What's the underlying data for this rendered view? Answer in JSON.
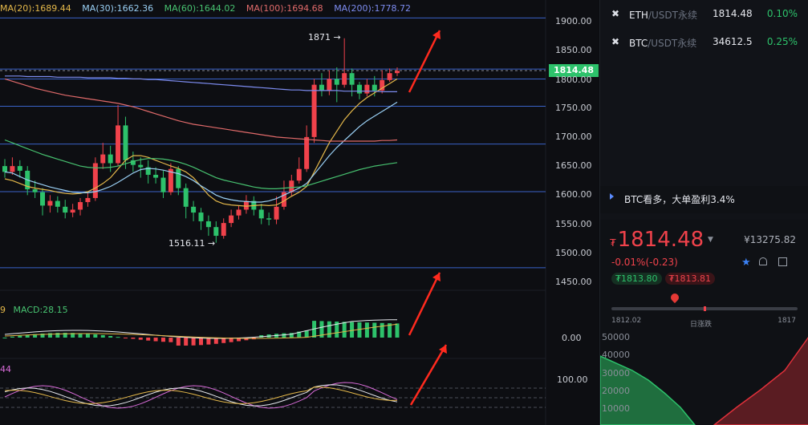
{
  "ma_legend": [
    {
      "label": "MA(20):1689.44",
      "color": "#e4b84a"
    },
    {
      "label": "MA(30):1662.36",
      "color": "#9ad0f5"
    },
    {
      "label": "MA(60):1644.02",
      "color": "#47c270"
    },
    {
      "label": "MA(100):1694.68",
      "color": "#e06a6a"
    },
    {
      "label": "MA(200):1778.72",
      "color": "#7d8cf0"
    }
  ],
  "annotations": {
    "high": "1871",
    "low": "1516.11",
    "current_price_tag": "1814.48"
  },
  "price_axis": [
    "1900.00",
    "1850.00",
    "1800.00",
    "1750.00",
    "1700.00",
    "1650.00",
    "1600.00",
    "1550.00",
    "1500.00",
    "1450.00"
  ],
  "macd": {
    "prefix": "9",
    "label": "MACD:28.15",
    "axis": "0.00"
  },
  "kdj": {
    "prefix": "44",
    "axis": "100.00"
  },
  "tickers": [
    {
      "symbol": "ETH",
      "pair": "/USDT永续",
      "price": "1814.48",
      "change": "0.10%"
    },
    {
      "symbol": "BTC",
      "pair": "/USDT永续",
      "price": "34612.5",
      "change": "0.25%"
    }
  ],
  "news": "BTC看多，大单盈利3.4%",
  "quote": {
    "currency": "₮",
    "price": "1814.48",
    "volume": "¥13275.82",
    "change": "-0.01%(-0.23)",
    "bid": "₮1813.80",
    "ask": "₮1813.81",
    "range_low": "1812.02",
    "range_high": "1817",
    "range_title": "日涨跌",
    "range_position": 0.5
  },
  "depth_axis": [
    "50000",
    "40000",
    "30000",
    "20000",
    "10000"
  ],
  "colors": {
    "up": "#2dc26b",
    "down": "#f0424b",
    "accent": "#3b82f6",
    "price_tag_bg": "#2dc26b"
  },
  "chart_data": {
    "type": "candlestick",
    "ylim": [
      1440,
      1915
    ],
    "horizontal_levels": [
      1905,
      1817,
      1800,
      1753,
      1688,
      1606,
      1475
    ],
    "candles": [
      [
        1650,
        1640,
        1662,
        1630
      ],
      [
        1640,
        1650,
        1665,
        1635
      ],
      [
        1650,
        1642,
        1660,
        1630
      ],
      [
        1642,
        1610,
        1650,
        1600
      ],
      [
        1610,
        1605,
        1625,
        1595
      ],
      [
        1605,
        1582,
        1612,
        1565
      ],
      [
        1582,
        1590,
        1600,
        1570
      ],
      [
        1590,
        1580,
        1598,
        1570
      ],
      [
        1580,
        1570,
        1592,
        1560
      ],
      [
        1570,
        1575,
        1585,
        1562
      ],
      [
        1575,
        1588,
        1595,
        1565
      ],
      [
        1588,
        1595,
        1605,
        1580
      ],
      [
        1595,
        1655,
        1665,
        1590
      ],
      [
        1655,
        1670,
        1690,
        1645
      ],
      [
        1670,
        1655,
        1685,
        1640
      ],
      [
        1655,
        1720,
        1755,
        1650
      ],
      [
        1720,
        1660,
        1735,
        1645
      ],
      [
        1660,
        1652,
        1675,
        1640
      ],
      [
        1652,
        1648,
        1665,
        1630
      ],
      [
        1648,
        1635,
        1660,
        1620
      ],
      [
        1635,
        1630,
        1648,
        1620
      ],
      [
        1630,
        1605,
        1642,
        1595
      ],
      [
        1605,
        1645,
        1655,
        1600
      ],
      [
        1645,
        1612,
        1650,
        1600
      ],
      [
        1612,
        1580,
        1620,
        1560
      ],
      [
        1580,
        1570,
        1590,
        1555
      ],
      [
        1570,
        1555,
        1578,
        1540
      ],
      [
        1555,
        1545,
        1565,
        1530
      ],
      [
        1545,
        1530,
        1555,
        1518
      ],
      [
        1530,
        1552,
        1560,
        1525
      ],
      [
        1552,
        1565,
        1575,
        1545
      ],
      [
        1565,
        1575,
        1582,
        1558
      ],
      [
        1575,
        1590,
        1600,
        1568
      ],
      [
        1590,
        1575,
        1598,
        1565
      ],
      [
        1575,
        1560,
        1585,
        1550
      ],
      [
        1560,
        1558,
        1570,
        1548
      ],
      [
        1558,
        1580,
        1598,
        1550
      ],
      [
        1580,
        1605,
        1625,
        1575
      ],
      [
        1605,
        1625,
        1635,
        1598
      ],
      [
        1625,
        1645,
        1665,
        1620
      ],
      [
        1645,
        1700,
        1720,
        1640
      ],
      [
        1700,
        1790,
        1800,
        1690
      ],
      [
        1790,
        1780,
        1810,
        1770
      ],
      [
        1780,
        1800,
        1815,
        1772
      ],
      [
        1800,
        1790,
        1820,
        1760
      ],
      [
        1790,
        1810,
        1870,
        1785
      ],
      [
        1810,
        1790,
        1818,
        1770
      ],
      [
        1790,
        1775,
        1795,
        1765
      ],
      [
        1775,
        1790,
        1800,
        1770
      ],
      [
        1790,
        1780,
        1805,
        1770
      ],
      [
        1780,
        1798,
        1815,
        1775
      ],
      [
        1798,
        1810,
        1818,
        1795
      ],
      [
        1810,
        1814,
        1820,
        1805
      ]
    ],
    "ma_lines": {
      "ma20": [
        1628,
        1625,
        1620,
        1615,
        1612,
        1610,
        1608,
        1605,
        1603,
        1602,
        1603,
        1606,
        1612,
        1620,
        1630,
        1645,
        1660,
        1668,
        1668,
        1665,
        1660,
        1655,
        1650,
        1646,
        1640,
        1630,
        1615,
        1600,
        1590,
        1585,
        1583,
        1582,
        1581,
        1582,
        1583,
        1582,
        1583,
        1590,
        1598,
        1605,
        1615,
        1640,
        1665,
        1690,
        1710,
        1730,
        1745,
        1758,
        1768,
        1776,
        1784,
        1792,
        1800
      ],
      "ma30": [
        1640,
        1638,
        1632,
        1626,
        1622,
        1618,
        1614,
        1611,
        1608,
        1605,
        1604,
        1604,
        1606,
        1610,
        1615,
        1622,
        1630,
        1638,
        1644,
        1646,
        1645,
        1643,
        1640,
        1637,
        1632,
        1625,
        1616,
        1608,
        1600,
        1595,
        1592,
        1590,
        1589,
        1588,
        1588,
        1590,
        1594,
        1600,
        1606,
        1612,
        1620,
        1636,
        1652,
        1668,
        1682,
        1694,
        1706,
        1718,
        1728,
        1736,
        1744,
        1752,
        1760
      ],
      "ma60": [
        1695,
        1690,
        1685,
        1680,
        1675,
        1670,
        1666,
        1662,
        1658,
        1654,
        1650,
        1648,
        1647,
        1647,
        1648,
        1650,
        1654,
        1658,
        1661,
        1663,
        1663,
        1662,
        1660,
        1657,
        1653,
        1648,
        1642,
        1636,
        1630,
        1626,
        1623,
        1620,
        1617,
        1614,
        1612,
        1611,
        1611,
        1612,
        1613,
        1614,
        1616,
        1620,
        1624,
        1628,
        1632,
        1636,
        1640,
        1644,
        1647,
        1650,
        1652,
        1654,
        1656
      ],
      "ma100": [
        1800,
        1796,
        1792,
        1788,
        1784,
        1781,
        1778,
        1775,
        1772,
        1770,
        1768,
        1766,
        1764,
        1762,
        1760,
        1758,
        1755,
        1752,
        1748,
        1744,
        1740,
        1736,
        1732,
        1728,
        1725,
        1722,
        1720,
        1718,
        1716,
        1714,
        1712,
        1710,
        1708,
        1706,
        1704,
        1702,
        1700,
        1699,
        1698,
        1697,
        1696,
        1695,
        1694,
        1693,
        1693,
        1693,
        1693,
        1693,
        1693,
        1693,
        1694,
        1694,
        1695
      ],
      "ma200": [
        1805,
        1805,
        1805,
        1804,
        1804,
        1804,
        1804,
        1803,
        1803,
        1803,
        1803,
        1802,
        1802,
        1802,
        1802,
        1801,
        1801,
        1800,
        1800,
        1799,
        1799,
        1798,
        1797,
        1796,
        1795,
        1794,
        1793,
        1792,
        1791,
        1790,
        1789,
        1788,
        1787,
        1786,
        1785,
        1784,
        1783,
        1782,
        1781,
        1781,
        1780,
        1780,
        1780,
        1780,
        1780,
        1779,
        1779,
        1779,
        1779,
        1779,
        1778,
        1778,
        1778
      ]
    }
  }
}
